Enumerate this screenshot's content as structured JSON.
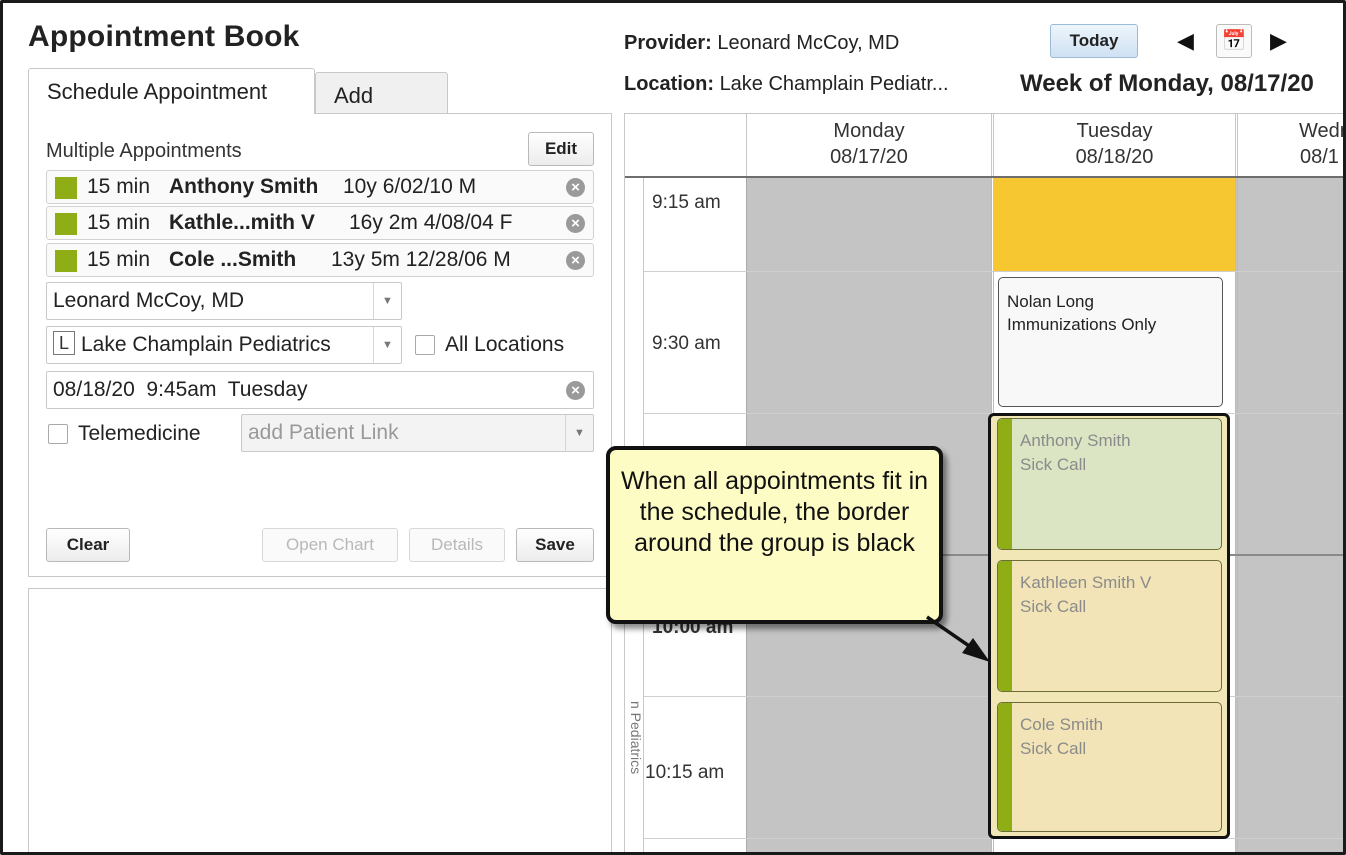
{
  "app": {
    "title": "Appointment Book"
  },
  "tabs": [
    {
      "label": "Schedule Appointment",
      "active": true
    },
    {
      "label": "Add Block",
      "active": false
    }
  ],
  "form": {
    "section_label": "Multiple Appointments",
    "edit_label": "Edit",
    "appointments": [
      {
        "duration": "15 min",
        "name": "Anthony Smith",
        "demographics": "10y 6/02/10 M",
        "color": "#8fae16"
      },
      {
        "duration": "15 min",
        "name": "Kathle...mith V",
        "demographics": "16y 2m 4/08/04 F",
        "color": "#8fae16"
      },
      {
        "duration": "15 min",
        "name": "Cole ...Smith",
        "demographics": "13y 5m 12/28/06 M",
        "color": "#8fae16"
      }
    ],
    "provider_value": "Leonard McCoy, MD",
    "location_badge": "L",
    "location_value": "Lake Champlain Pediatrics",
    "all_locations_label": "All Locations",
    "datetime_value": "08/18/20  9:45am  Tuesday",
    "telemedicine_label": "Telemedicine",
    "patient_link_placeholder": "add Patient Link",
    "clear_label": "Clear",
    "open_chart_label": "Open Chart",
    "details_label": "Details",
    "save_label": "Save"
  },
  "header": {
    "provider_key": "Provider:",
    "provider_value": "Leonard McCoy, MD",
    "location_key": "Location:",
    "location_value": "Lake Champlain Pediatr...",
    "today_label": "Today",
    "week_label": "Week of Monday, 08/17/20"
  },
  "calendar": {
    "days": [
      {
        "name": "Monday",
        "date": "08/17/20"
      },
      {
        "name": "Tuesday",
        "date": "08/18/20"
      },
      {
        "name": "Wedr",
        "date": "08/1"
      }
    ],
    "times": [
      "9:15 am",
      "9:30 am",
      "10:00 am",
      "10:15 am"
    ],
    "gutter_label": "n Pediatrics",
    "appointments": [
      {
        "line1": "Nolan Long",
        "line2": "Immunizations Only"
      },
      {
        "line1": "Anthony Smith",
        "line2": "Sick Call"
      },
      {
        "line1": "Kathleen Smith V",
        "line2": "Sick Call"
      },
      {
        "line1": "Cole Smith",
        "line2": "Sick Call"
      }
    ],
    "colors": {
      "blocked": "#c4c4c4",
      "highlight": "#f6c731",
      "group_bg": "#f0e6b6",
      "appt_green": "#dbe5c4",
      "appt_tan": "#f2e4b7",
      "accent_bar": "#8fae16"
    }
  },
  "callout": {
    "text": "When all appointments fit in the schedule, the border around the group is black"
  }
}
